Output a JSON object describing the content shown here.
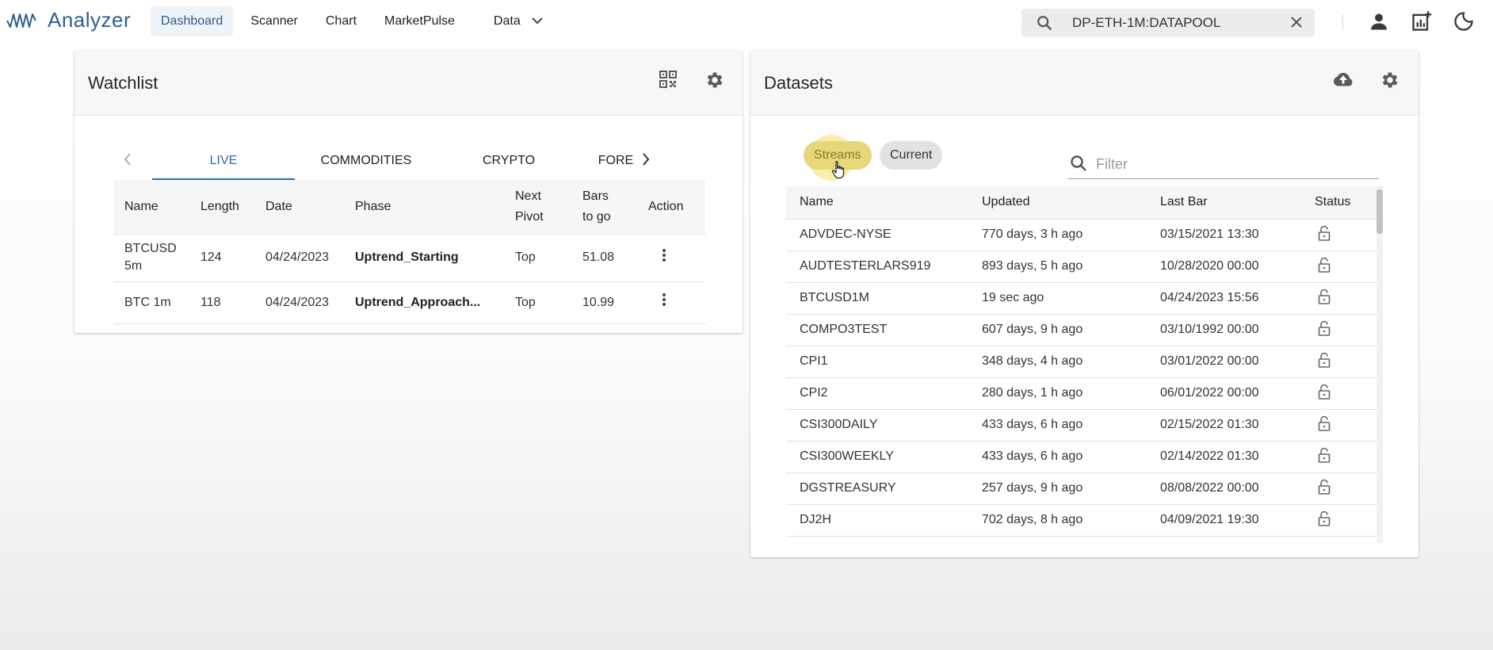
{
  "app": {
    "name": "Analyzer",
    "brand_color": "#2f5f8f",
    "accent_color": "#2f6bb0"
  },
  "nav": {
    "items": [
      {
        "label": "Dashboard",
        "active": true
      },
      {
        "label": "Scanner"
      },
      {
        "label": "Chart"
      },
      {
        "label": "MarketPulse"
      },
      {
        "label": "Data",
        "has_dropdown": true
      }
    ]
  },
  "search": {
    "value": "DP-ETH-1M:DATAPOOL",
    "icon": "search-icon",
    "clear_icon": "close-icon"
  },
  "toolbar_icons": [
    "account-icon",
    "add-chart-icon",
    "dark-mode-icon"
  ],
  "watchlist": {
    "title": "Watchlist",
    "header_icons": [
      "qr-code-icon",
      "gear-icon"
    ],
    "tabs": [
      {
        "label": "LIVE",
        "active": true
      },
      {
        "label": "COMMODITIES"
      },
      {
        "label": "CRYPTO"
      },
      {
        "label": "FORE"
      }
    ],
    "columns": {
      "name": "Name",
      "length": "Length",
      "date": "Date",
      "phase": "Phase",
      "next_pivot_1": "Next",
      "next_pivot_2": "Pivot",
      "bars_1": "Bars",
      "bars_2": "to go",
      "action": "Action"
    },
    "rows": [
      {
        "name_1": "BTCUSD",
        "name_2": "5m",
        "length": "124",
        "date": "04/24/2023",
        "phase": "Uptrend_Starting",
        "pivot": "Top",
        "bars": "51.08"
      },
      {
        "name_1": "BTC 1m",
        "name_2": "",
        "length": "118",
        "date": "04/24/2023",
        "phase": "Uptrend_Approach...",
        "pivot": "Top",
        "bars": "10.99"
      }
    ]
  },
  "datasets": {
    "title": "Datasets",
    "header_icons": [
      "cloud-upload-icon",
      "gear-icon"
    ],
    "chips": {
      "streams": "Streams",
      "current": "Current"
    },
    "filter": {
      "placeholder": "Filter"
    },
    "columns": {
      "name": "Name",
      "updated": "Updated",
      "last_bar": "Last Bar",
      "status": "Status"
    },
    "rows": [
      {
        "name": "ADVDEC-NYSE",
        "updated": "770 days, 3 h ago",
        "last_bar": "03/15/2021 13:30",
        "status": "lock-open-icon"
      },
      {
        "name": "AUDTESTERLARS919",
        "updated": "893 days, 5 h ago",
        "last_bar": "10/28/2020 00:00",
        "status": "lock-open-icon"
      },
      {
        "name": "BTCUSD1M",
        "updated": "19 sec ago",
        "last_bar": "04/24/2023 15:56",
        "status": "lock-open-icon"
      },
      {
        "name": "COMPO3TEST",
        "updated": "607 days, 9 h ago",
        "last_bar": "03/10/1992 00:00",
        "status": "lock-open-icon"
      },
      {
        "name": "CPI1",
        "updated": "348 days, 4 h ago",
        "last_bar": "03/01/2022 00:00",
        "status": "lock-open-icon"
      },
      {
        "name": "CPI2",
        "updated": "280 days, 1 h ago",
        "last_bar": "06/01/2022 00:00",
        "status": "lock-open-icon"
      },
      {
        "name": "CSI300DAILY",
        "updated": "433 days, 6 h ago",
        "last_bar": "02/15/2022 01:30",
        "status": "lock-open-icon"
      },
      {
        "name": "CSI300WEEKLY",
        "updated": "433 days, 6 h ago",
        "last_bar": "02/14/2022 01:30",
        "status": "lock-open-icon"
      },
      {
        "name": "DGSTREASURY",
        "updated": "257 days, 9 h ago",
        "last_bar": "08/08/2022 00:00",
        "status": "lock-open-icon"
      },
      {
        "name": "DJ2H",
        "updated": "702 days, 8 h ago",
        "last_bar": "04/09/2021 19:30",
        "status": "lock-open-icon"
      }
    ]
  }
}
